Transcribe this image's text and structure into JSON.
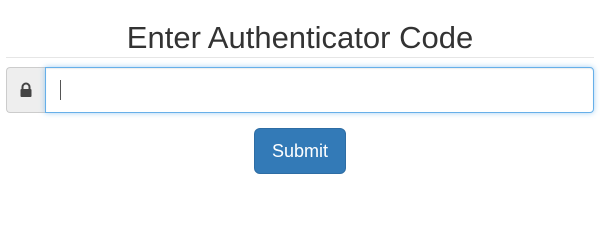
{
  "page": {
    "title": "Enter Authenticator Code"
  },
  "code_field": {
    "value": "",
    "placeholder": "",
    "icon": "lock-icon"
  },
  "actions": {
    "submit_label": "Submit"
  },
  "colors": {
    "primary": "#337ab7",
    "focus_border": "#66afe9",
    "addon_bg": "#eeeeee",
    "title_text": "#333333"
  }
}
